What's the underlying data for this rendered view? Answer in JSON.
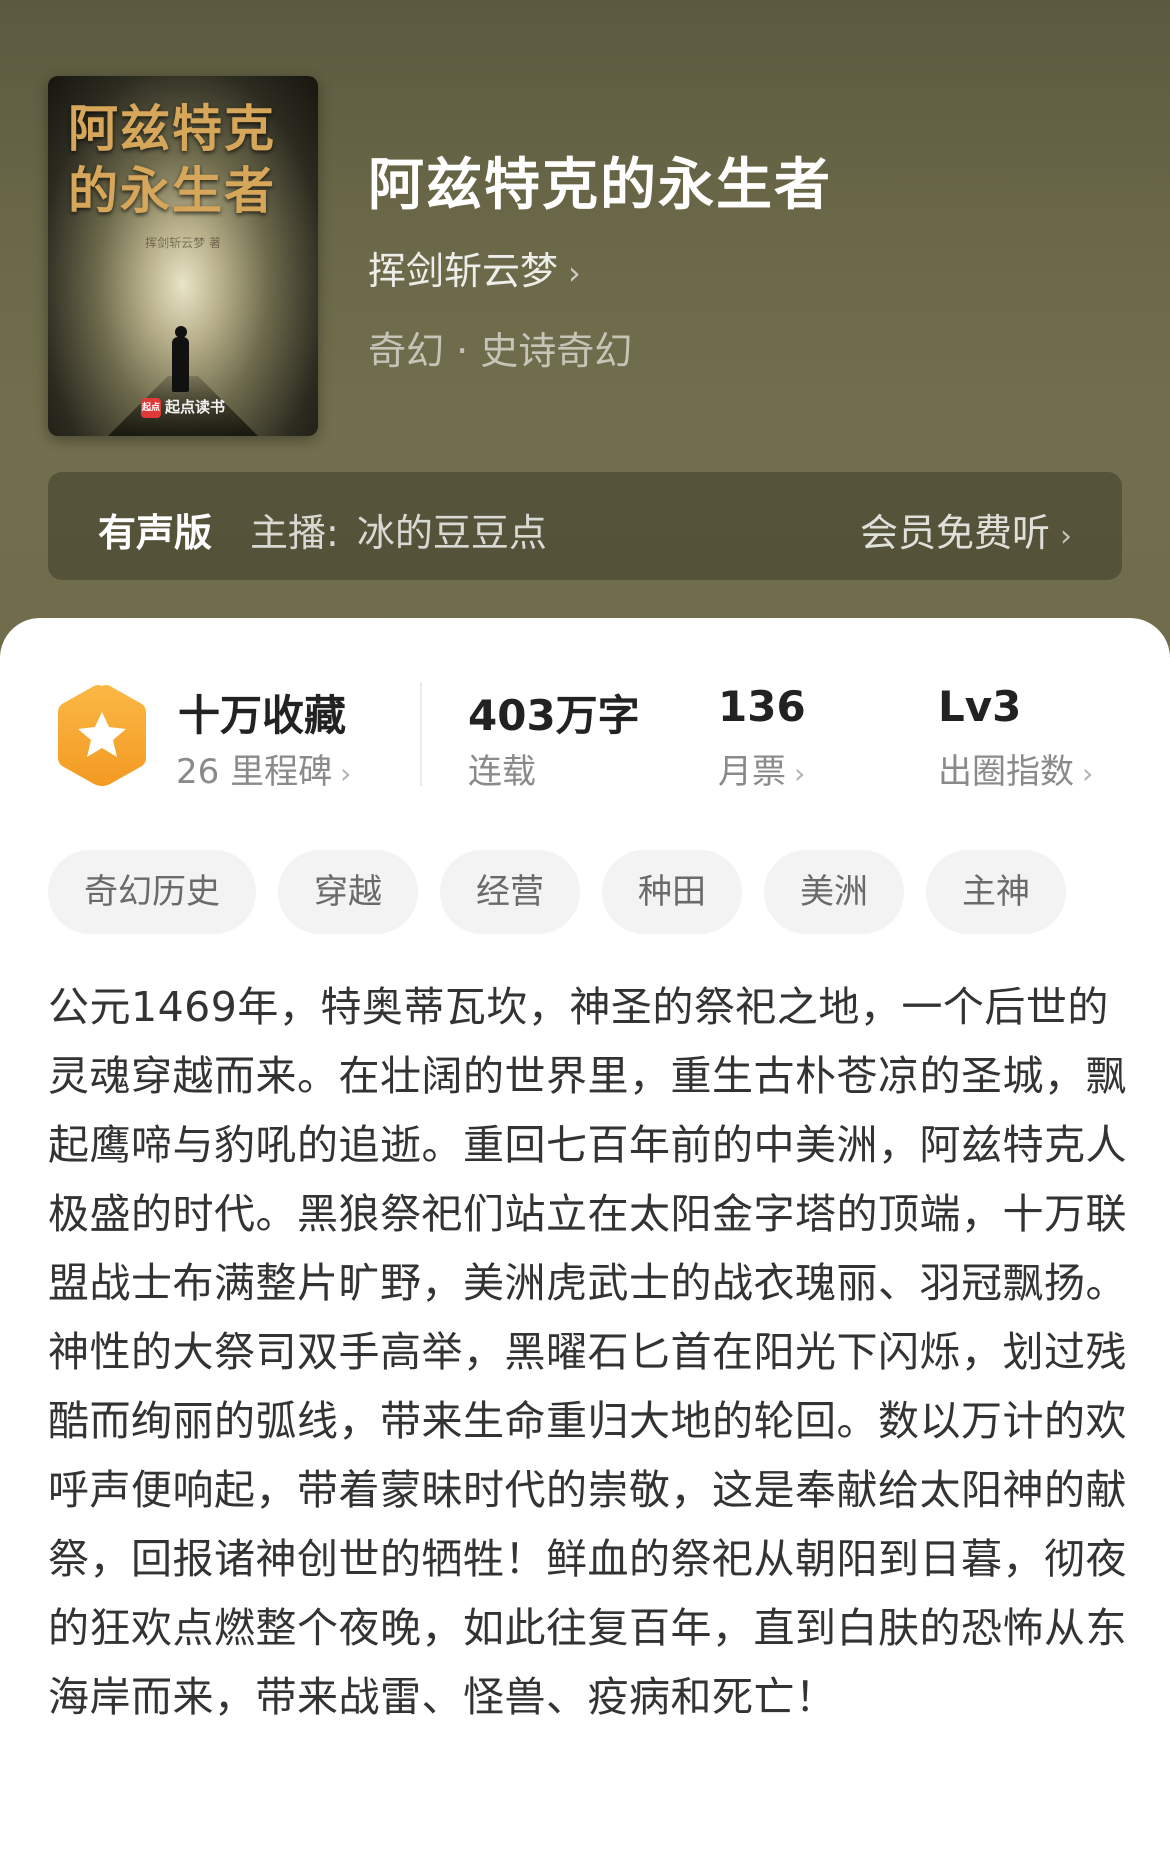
{
  "book": {
    "cover": {
      "title_art": "阿兹特克\n的永生者",
      "subtitle_art": "挥剑斩云梦 著",
      "publisher_logo": "起点读书",
      "logo_mark": "起点"
    },
    "title": "阿兹特克的永生者",
    "author": "挥剑斩云梦",
    "category": "奇幻 · 史诗奇幻"
  },
  "audio": {
    "badge": "有声版",
    "host_label": "主播:",
    "host_name": "冰的豆豆点",
    "link": "会员免费听"
  },
  "stats": {
    "collect_title": "十万收藏",
    "collect_sub": "26 里程碑",
    "words_value": "403万字",
    "words_sub": "连载",
    "tickets_value": "136",
    "tickets_sub": "月票",
    "level_value": "Lv3",
    "level_sub": "出圈指数"
  },
  "tags": [
    "奇幻历史",
    "穿越",
    "经营",
    "种田",
    "美洲",
    "主神"
  ],
  "description": {
    "para1": "公元1469年，特奥蒂瓦坎，神圣的祭祀之地，一个后世的灵魂穿越而来。在壮阔的世界里，重生古朴苍凉的圣城，飘起鹰啼与豹吼的追逝。重回七百年前的中美洲，阿兹特克人极盛的时代。黑狼祭祀们站立在太阳金字塔的顶端，十万联盟战士布满整片旷野，美洲虎武士的战衣瑰丽、羽冠飘扬。",
    "para2": "神性的大祭司双手高举，黑曜石匕首在阳光下闪烁，划过残酷而绚丽的弧线，带来生命重归大地的轮回。数以万计的欢呼声便响起，带着蒙昧时代的崇敬，这是奉献给太阳神的献祭，回报诸神创世的牺牲！鲜血的祭祀从朝阳到日暮，彻夜的狂欢点燃整个夜晚，如此往复百年，直到白肤的恐怖从东海岸而来，带来战雷、怪兽、疫病和死亡！"
  },
  "icons": {
    "chevron": "chevron-right-icon",
    "collect_badge": "star-hexagon-icon"
  },
  "colors": {
    "header_bg": "#6a6848",
    "badge_orange": "#f7a534",
    "text_primary": "#222222",
    "text_secondary": "#8a8a8a"
  }
}
